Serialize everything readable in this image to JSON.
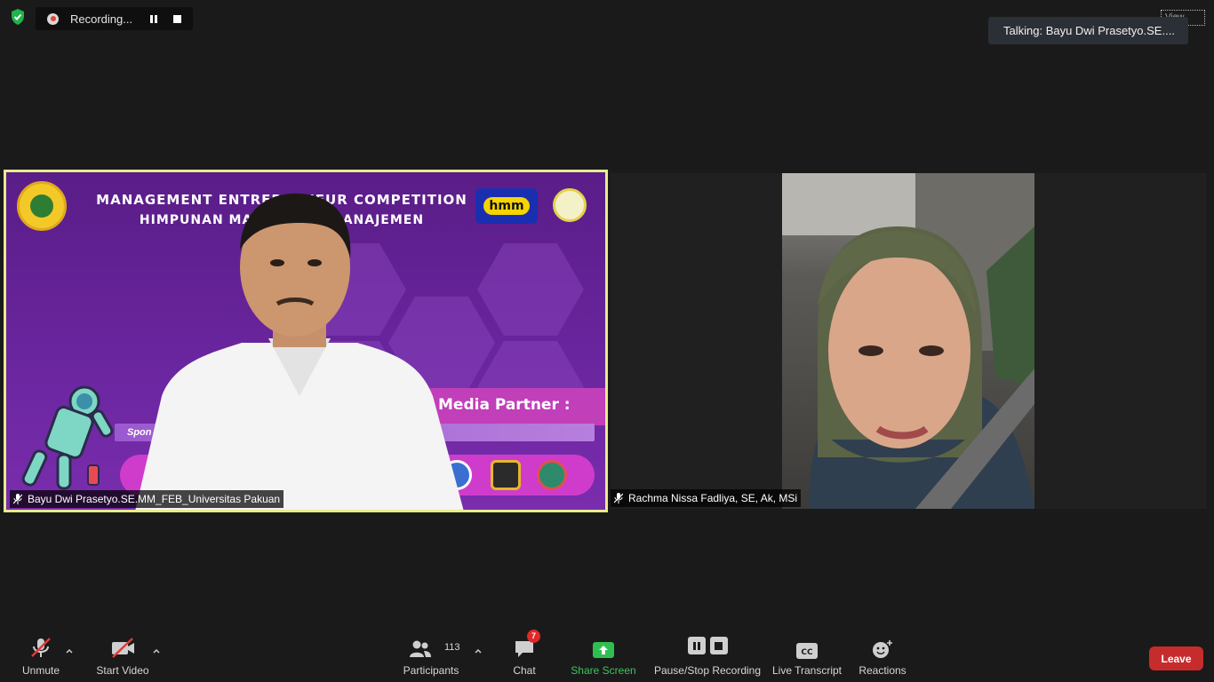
{
  "top_bar": {
    "recording_label": "Recording...",
    "view_label": "View",
    "talking_label": "Talking: Bayu Dwi Prasetyo.SE...."
  },
  "slide": {
    "title": "MANAGEMENT ENTREPRENEUR COMPETITION",
    "subtitle": "HIMPUNAN MAHASISWA MANAJEMEN",
    "hmm_logo": "hmm",
    "media_partner": "Media Partner :",
    "sponsor": "Spon"
  },
  "participants": {
    "left_name": "Bayu Dwi Prasetyo.SE.MM_FEB_Universitas Pakuan",
    "right_name": "Rachma Nissa Fadliya, SE, Ak, MSi"
  },
  "toolbar": {
    "unmute": "Unmute",
    "start_video": "Start Video",
    "participants_label": "Participants",
    "participants_count": "113",
    "chat_label": "Chat",
    "chat_badge": "7",
    "share_screen": "Share Screen",
    "pause_stop_recording": "Pause/Stop Recording",
    "live_transcript": "Live Transcript",
    "reactions": "Reactions",
    "leave": "Leave"
  },
  "colors": {
    "active_speaker_border": "#e7ec8c",
    "share_green": "#3ec45a",
    "leave_red": "#c62c2c",
    "badge_red": "#e02828"
  },
  "icons": {
    "security": "shield-check-icon",
    "recording": "record-dot-icon",
    "pause": "pause-icon",
    "stop": "stop-icon",
    "mic_muted": "mic-muted-icon",
    "video_off": "video-off-icon",
    "participants": "people-icon",
    "chat": "chat-bubble-icon",
    "share": "share-up-arrow-icon",
    "cc": "cc-icon",
    "reactions": "smiley-plus-icon"
  }
}
